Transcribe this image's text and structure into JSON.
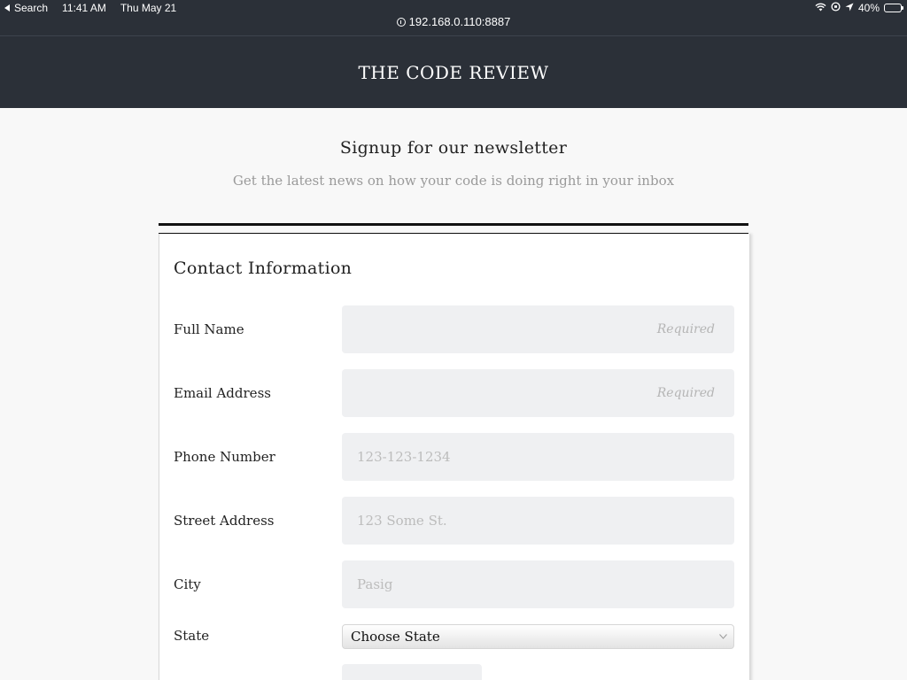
{
  "status_bar": {
    "back_label": "Search",
    "time": "11:41 AM",
    "date": "Thu May 21",
    "battery_text": "40%",
    "battery_level": 0.4,
    "url": "192.168.0.110:8887"
  },
  "header": {
    "title": "THE CODE REVIEW"
  },
  "intro": {
    "title": "Signup for our newsletter",
    "subtitle": "Get the latest news on how your code is doing right in your inbox"
  },
  "form": {
    "section_title": "Contact Information",
    "fields": {
      "full_name": {
        "label": "Full Name",
        "placeholder": "Required",
        "value": ""
      },
      "email": {
        "label": "Email Address",
        "placeholder": "Required",
        "value": ""
      },
      "phone": {
        "label": "Phone Number",
        "placeholder": "123-123-1234",
        "value": ""
      },
      "street": {
        "label": "Street Address",
        "placeholder": "123 Some St.",
        "value": ""
      },
      "city": {
        "label": "City",
        "placeholder": "Pasig",
        "value": ""
      },
      "state": {
        "label": "State",
        "selected": "Choose State"
      }
    }
  },
  "colors": {
    "header_bg": "#2b3038",
    "page_bg": "#f8f8f8",
    "field_bg": "#eff0f2",
    "placeholder": "#bcbcbc",
    "battery_green": "#4cd964"
  },
  "icons": [
    "back-arrow-icon",
    "wifi-icon",
    "orientation-lock-icon",
    "location-icon",
    "battery-icon",
    "info-icon",
    "chevron-down-icon"
  ]
}
